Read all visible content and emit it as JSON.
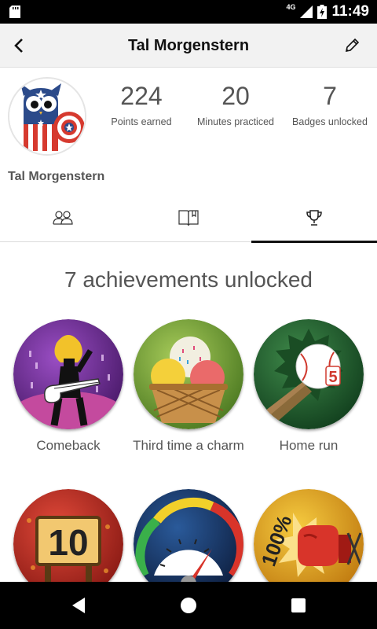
{
  "status_bar": {
    "time": "11:49",
    "network": "4G"
  },
  "app_bar": {
    "title": "Tal Morgenstern"
  },
  "profile": {
    "name": "Tal Morgenstern",
    "stats": [
      {
        "value": "224",
        "label": "Points earned"
      },
      {
        "value": "20",
        "label": "Minutes practiced"
      },
      {
        "value": "7",
        "label": "Badges unlocked"
      }
    ]
  },
  "tabs": [
    {
      "icon": "people-icon",
      "active": false
    },
    {
      "icon": "book-icon",
      "active": false
    },
    {
      "icon": "trophy-icon",
      "active": true
    }
  ],
  "achievements": {
    "heading": "7 achievements unlocked",
    "badges": [
      {
        "label": "Comeback",
        "color": "#6a2a8c"
      },
      {
        "label": "Third time a charm",
        "color": "#7aa83a"
      },
      {
        "label": "Home run",
        "color": "#1f5f2e"
      },
      {
        "label": "",
        "color": "#c0281e"
      },
      {
        "label": "",
        "color": "#1e3a6a"
      },
      {
        "label": "",
        "color": "#e0a020"
      }
    ]
  },
  "nav": {
    "back": "back-icon",
    "home": "home-icon",
    "recents": "recents-icon"
  }
}
